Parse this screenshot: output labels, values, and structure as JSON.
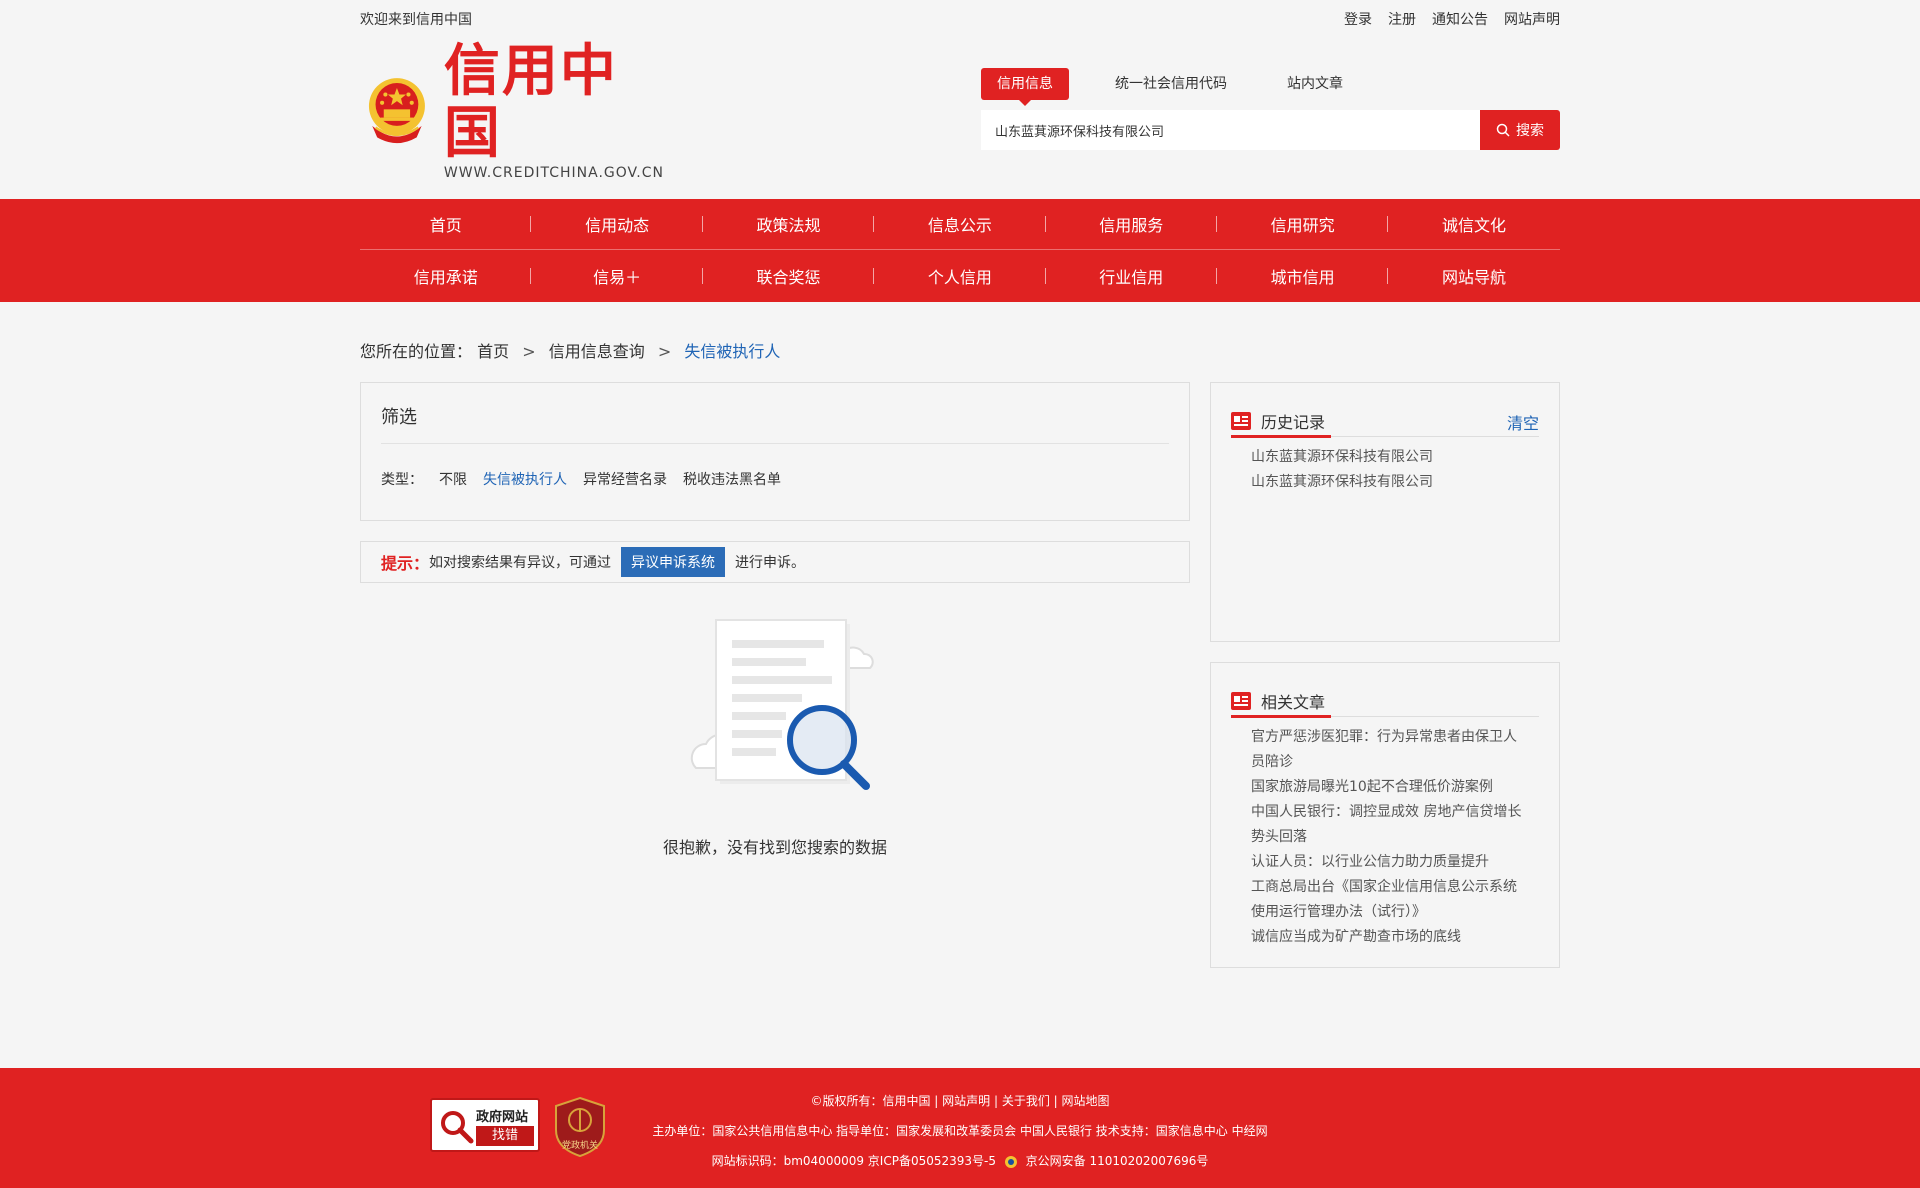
{
  "topbar": {
    "welcome": "欢迎来到信用中国",
    "links": [
      "登录",
      "注册",
      "通知公告",
      "网站声明"
    ]
  },
  "logo": {
    "cn": "信用中国",
    "en": "WWW.CREDITCHINA.GOV.CN"
  },
  "search": {
    "tabs": [
      "信用信息",
      "统一社会信用代码",
      "站内文章"
    ],
    "value": "山东蓝萁源环保科技有限公司",
    "button": "搜索"
  },
  "nav": {
    "row1": [
      "首页",
      "信用动态",
      "政策法规",
      "信息公示",
      "信用服务",
      "信用研究",
      "诚信文化"
    ],
    "row2": [
      "信用承诺",
      "信易＋",
      "联合奖惩",
      "个人信用",
      "行业信用",
      "城市信用",
      "网站导航"
    ]
  },
  "breadcrumb": {
    "prefix": "您所在的位置：",
    "home": "首页",
    "sep": ">",
    "level2": "信用信息查询",
    "current": "失信被执行人"
  },
  "filter": {
    "title": "筛选",
    "label": "类型：",
    "options": [
      "不限",
      "失信被执行人",
      "异常经营名录",
      "税收违法黑名单"
    ]
  },
  "tip": {
    "label": "提示：",
    "text": "如对搜索结果有异议，可通过",
    "button": "异议申诉系统",
    "suffix": "进行申诉。"
  },
  "empty": {
    "text": "很抱歉，没有找到您搜索的数据"
  },
  "history": {
    "title": "历史记录",
    "clear": "清空",
    "items": [
      "山东蓝萁源环保科技有限公司",
      "山东蓝萁源环保科技有限公司"
    ]
  },
  "articles": {
    "title": "相关文章",
    "items": [
      "官方严惩涉医犯罪：行为异常患者由保卫人员陪诊",
      "国家旅游局曝光10起不合理低价游案例",
      "中国人民银行：调控显成效 房地产信贷增长势头回落",
      "认证人员：以行业公信力助力质量提升",
      "工商总局出台《国家企业信用信息公示系统使用运行管理办法（试行）》",
      "诚信应当成为矿产勘查市场的底线"
    ]
  },
  "footer": {
    "line1": "©版权所有：信用中国 | 网站声明 | 关于我们 | 网站地图",
    "line2": "主办单位：国家公共信用信息中心    指导单位：国家发展和改革委员会 中国人民银行    技术支持：国家信息中心 中经网",
    "line3a": "网站标识码：bm04000009 京ICP备05052393号-5",
    "line3b": "京公网安备 11010202007696号",
    "gov_badge_top": "政府网站",
    "gov_badge_bottom": "找错",
    "party_badge": "党政机关"
  },
  "colors": {
    "brand_red": "#e02222",
    "link_blue": "#1f64b5",
    "button_blue": "#2b6cb7"
  }
}
